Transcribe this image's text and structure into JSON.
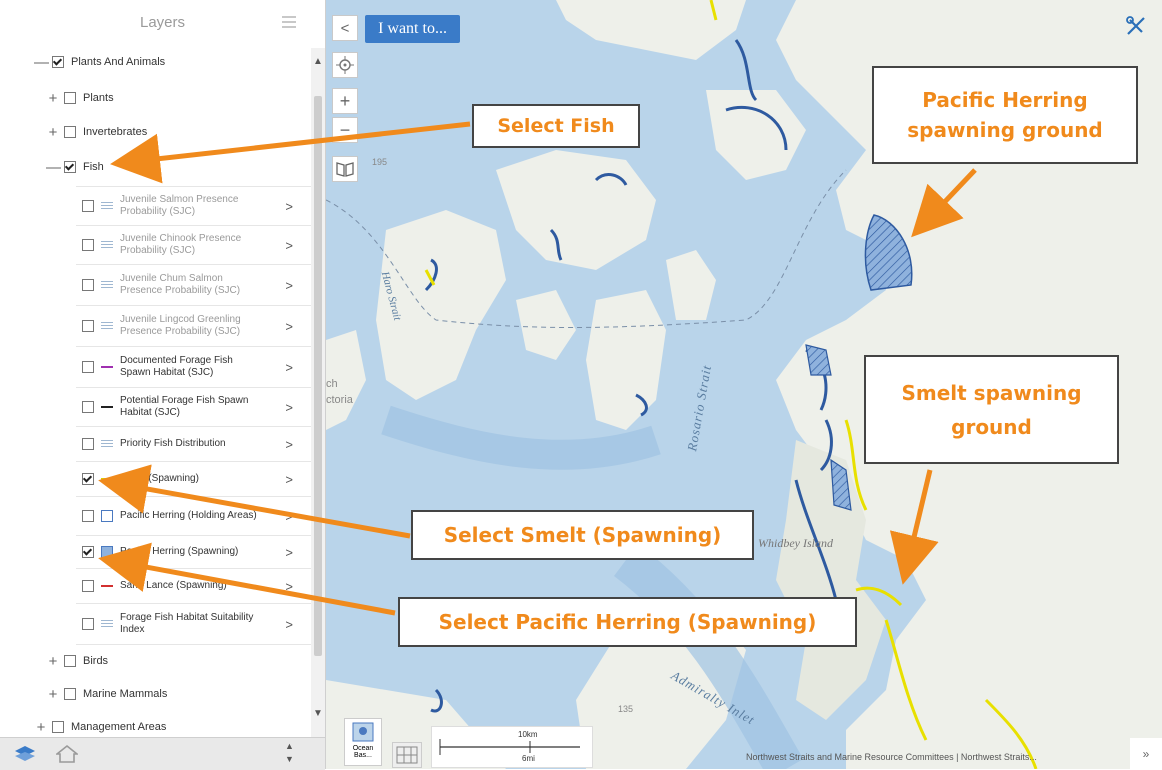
{
  "panel": {
    "title": "Layers",
    "layers": [
      {
        "label": "Plants And Animals",
        "expander": "—",
        "checked": true
      },
      {
        "label": "Plants",
        "expander": "+",
        "checked": false
      },
      {
        "label": "Invertebrates",
        "expander": "+",
        "checked": false
      },
      {
        "label": "Fish",
        "expander": "—",
        "checked": true
      }
    ],
    "fish_layers": [
      {
        "label": "Juvenile Salmon Presence Probability (SJC)",
        "checked": false,
        "legend": "lines-icon"
      },
      {
        "label": "Juvenile Chinook Presence Probability (SJC)",
        "checked": false,
        "legend": "lines-icon"
      },
      {
        "label": "Juvenile Chum Salmon Presence Probability (SJC)",
        "checked": false,
        "legend": "lines-icon"
      },
      {
        "label": "Juvenile Lingcod Greenling Presence Probability (SJC)",
        "checked": false,
        "legend": "lines-icon"
      },
      {
        "label": "Documented Forage Fish Spawn Habitat (SJC)",
        "checked": false,
        "legend": "purple-line-icon"
      },
      {
        "label": "Potential Forage Fish Spawn Habitat (SJC)",
        "checked": false,
        "legend": "black-line-icon"
      },
      {
        "label": "Priority Fish Distribution",
        "checked": false,
        "legend": "lines-icon"
      },
      {
        "label": "Smelt (Spawning)",
        "checked": true,
        "legend": "yellow-line-icon"
      },
      {
        "label": "Pacific Herring (Holding Areas)",
        "checked": false,
        "legend": "outline-box-icon"
      },
      {
        "label": "Pacific Herring (Spawning)",
        "checked": true,
        "legend": "filled-box-icon"
      },
      {
        "label": "Sand Lance (Spawning)",
        "checked": false,
        "legend": "red-line-icon"
      },
      {
        "label": "Forage Fish Habitat Suitability Index",
        "checked": false,
        "legend": "lines-icon"
      }
    ],
    "bottom_layers": [
      {
        "label": "Birds",
        "expander": "+",
        "checked": false
      },
      {
        "label": "Marine Mammals",
        "expander": "+",
        "checked": false
      },
      {
        "label": "Management Areas",
        "expander": "+",
        "checked": false
      }
    ],
    "arrow_glyph": ">"
  },
  "map": {
    "i_want_to": "I want to...",
    "collapse_glyph": "<",
    "zoom_in": "+",
    "zoom_out": "−",
    "place_labels": {
      "haro": "Haro Strait",
      "rosario": "Rosario Strait",
      "whidbey": "Whidbey Island",
      "admiralty": "Admiralty Inlet",
      "ch": "ch",
      "ctoria": "ctoria",
      "n195": "195",
      "n135": "135"
    },
    "scale": {
      "km": "10km",
      "mi": "6mi"
    },
    "basemap_label": "Ocean Bas...",
    "attribution": "Northwest Straits and Marine Resource Committees | Northwest Straits...",
    "corner": "»"
  },
  "callouts": {
    "select_fish": "Select Fish",
    "herring_ground": "Pacific Herring spawning ground",
    "smelt_ground": "Smelt spawning ground",
    "select_smelt": "Select Smelt (Spawning)",
    "select_herring": "Select Pacific Herring (Spawning)"
  },
  "colors": {
    "accent_orange": "#f08a1c",
    "button_blue": "#3a7bc8",
    "water": "#b9d4ea",
    "land": "#eef0ea"
  }
}
